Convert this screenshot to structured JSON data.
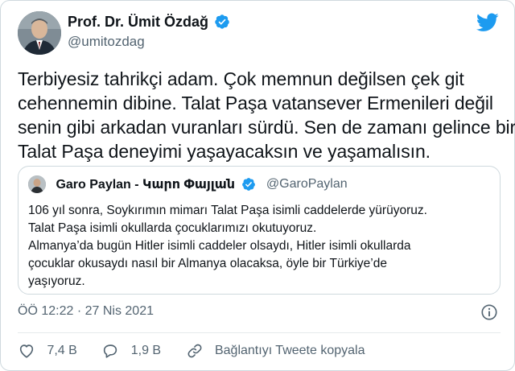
{
  "author": {
    "display_name": "Prof. Dr. Ümit Özdağ",
    "handle": "@umitozdag"
  },
  "tweet": {
    "lines": [
      "Terbiyesiz tahrikçi adam. Çok memnun değilsen çek git",
      "cehennemin dibine. Talat Paşa vatansever Ermenileri değil",
      "senin gibi arkadan vuranları sürdü. Sen de zamanı gelince bir",
      "Talat Paşa deneyimi yaşayacaksın ve yaşamalısın."
    ]
  },
  "quoted": {
    "display_name": "Garo Paylan - Կարո Փայլան",
    "handle": "@GaroPaylan",
    "lines": [
      "106 yıl sonra, Soykırımın mimarı Talat Paşa isimli caddelerde yürüyoruz.",
      "Talat Paşa isimli okullarda çocuklarımızı okutuyoruz.",
      "Almanya’da bugün Hitler isimli caddeler olsaydı, Hitler isimli okullarda",
      "çocuklar okusaydı nasıl bir Almanya olacaksa, öyle bir Türkiye’de",
      "yaşıyoruz."
    ]
  },
  "timestamp": "ÖÖ 12:22 · 27 Nis 2021",
  "actions": {
    "like_count": "7,4 B",
    "reply_count": "1,9 B",
    "copy_link_label": "Bağlantıyı Tweete kopyala"
  },
  "icons": {
    "verified": "verified-badge-icon",
    "brand": "twitter-bird-icon",
    "info": "info-icon",
    "like": "heart-icon",
    "reply": "speech-bubble-icon",
    "link": "link-icon"
  },
  "colors": {
    "brand_blue": "#1d9bf0",
    "secondary_text": "#536471",
    "border": "#cfd9de"
  }
}
